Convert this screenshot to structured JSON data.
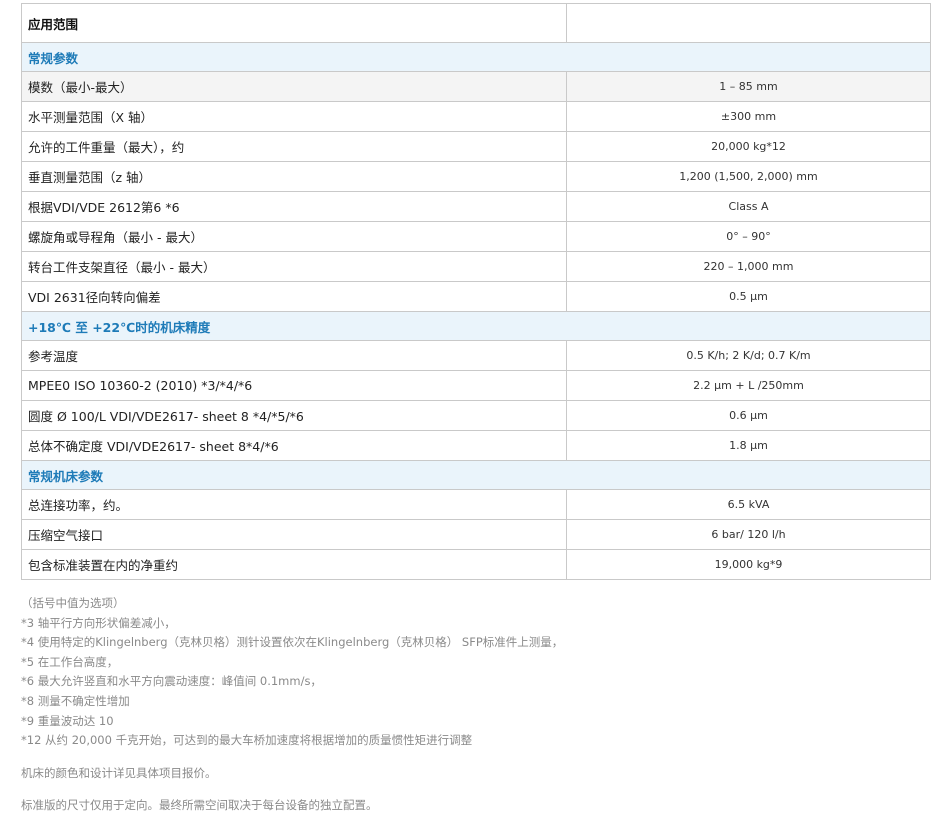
{
  "table": {
    "header": {
      "label": "应用范围",
      "value": ""
    },
    "sections": [
      {
        "title": "常规参数",
        "rows": [
          {
            "label": "模数（最小-最大）",
            "value": "1 – 85 mm"
          },
          {
            "label": "水平测量范围（X 轴）",
            "value": "±300 mm"
          },
          {
            "label": "允许的工件重量（最大），约",
            "value": "20,000 kg*12"
          },
          {
            "label": "垂直测量范围（z 轴）",
            "value": "1,200 (1,500, 2,000) mm"
          },
          {
            "label": "根据VDI/VDE 2612第6 *6",
            "value": "Class A"
          },
          {
            "label": "螺旋角或导程角（最小 - 最大）",
            "value": "0° – 90°"
          },
          {
            "label": "转台工件支架直径（最小 - 最大）",
            "value": "220 – 1,000 mm"
          },
          {
            "label": "VDI 2631径向转向偏差",
            "value": "0.5 µm"
          }
        ]
      },
      {
        "title": "+18℃ 至 +22℃时的机床精度",
        "rows": [
          {
            "label": "参考温度",
            "value": "0.5 K/h; 2 K/d; 0.7 K/m"
          },
          {
            "label": "MPEE0 ISO 10360-2 (2010) *3/*4/*6",
            "value": "2.2 µm + L /250mm"
          },
          {
            "label": "圆度 Ø 100/L VDI/VDE2617- sheet 8 *4/*5/*6",
            "value": "0.6 µm"
          },
          {
            "label": "总体不确定度 VDI/VDE2617- sheet 8*4/*6",
            "value": "1.8 µm"
          }
        ]
      },
      {
        "title": "常规机床参数",
        "rows": [
          {
            "label": "总连接功率，约。",
            "value": "6.5 kVA"
          },
          {
            "label": "压缩空气接口",
            "value": "6 bar/ 120 l/h"
          },
          {
            "label": "包含标准装置在内的净重约",
            "value": "19,000 kg*9"
          }
        ]
      }
    ]
  },
  "notes": [
    "（括号中值为选项）",
    "*3 轴平行方向形状偏差减小，",
    "*4 使用特定的Klingelnberg（克林贝格）测针设置依次在Klingelnberg（克林贝格） SFP标准件上测量，",
    "*5 在工作台高度，",
    "*6 最大允许竖直和水平方向震动速度：峰值间 0.1mm/s，",
    "*8 测量不确定性增加",
    "*9 重量波动达 10",
    "*12 从约 20,000 千克开始，可达到的最大车桥加速度将根据增加的质量惯性矩进行调整"
  ],
  "footer": {
    "color_note": "机床的颜色和设计详见具体项目报价。",
    "dimension_note": "标准版的尺寸仅用于定向。最终所需空间取决于每台设备的独立配置。"
  }
}
